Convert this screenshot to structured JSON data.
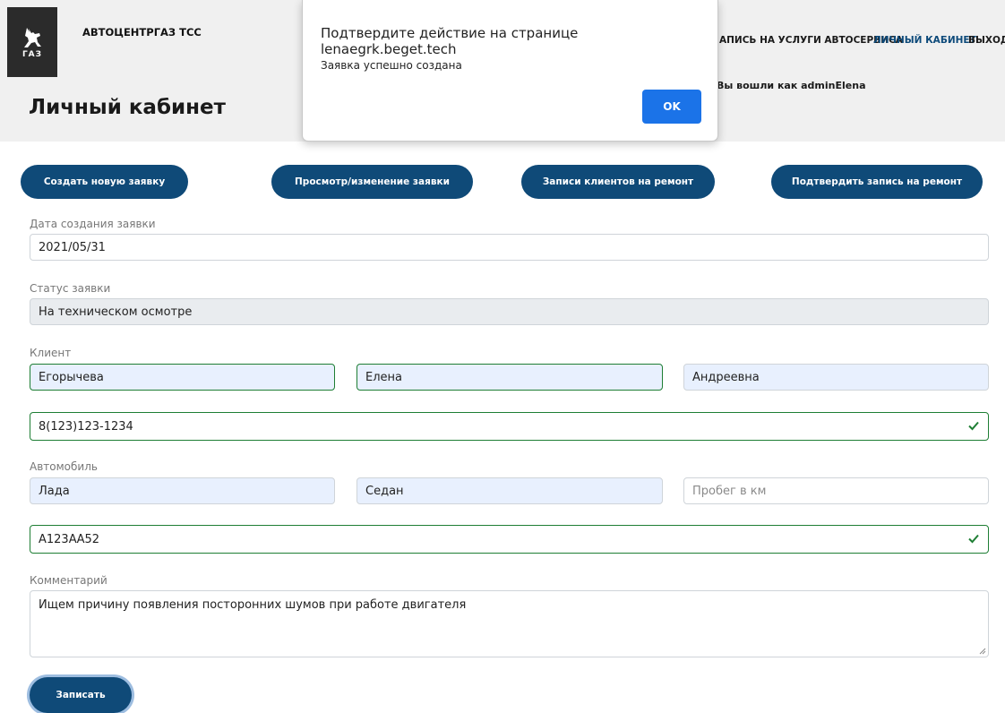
{
  "header": {
    "logo_text": "ГАЗ",
    "brand": "АВТОЦЕНТРГАЗ ТСС",
    "page_title": "Личный кабинет",
    "nav": [
      {
        "label": "АПИСЬ НА УСЛУГИ АВТОСЕРВИСА"
      },
      {
        "label": "ЛИЧНЫЙ КАБИНЕТ"
      },
      {
        "label": "ВЫХОД"
      }
    ],
    "logged_in": "Вы вошли как adminElena"
  },
  "dialog": {
    "title": "Подтвердите действие на странице lenaegrk.beget.tech",
    "message": "Заявка успешно создана",
    "ok_label": "OK"
  },
  "actions": [
    {
      "label": "Создать новую заявку"
    },
    {
      "label": "Просмотр/изменение заявки"
    },
    {
      "label": "Записи клиентов на ремонт"
    },
    {
      "label": "Подтвердить запись на ремонт"
    }
  ],
  "form": {
    "date_label": "Дата создания заявки",
    "date_value": "2021/05/31",
    "status_label": "Статус заявки",
    "status_value": "На техническом осмотре",
    "client_label": "Клиент",
    "last_name": "Егорычева",
    "first_name": "Елена",
    "patronymic": "Андреевна",
    "phone": "8(123)123-1234",
    "car_label": "Автомобиль",
    "car_brand": "Лада",
    "car_body": "Седан",
    "mileage_placeholder": "Пробег в км",
    "plate": "А123АА52",
    "comment_label": "Комментарий",
    "comment": "Ищем причину появления посторонних шумов при работе двигателя",
    "submit_label": "Записать"
  },
  "colors": {
    "primary": "#0f4a78",
    "dialog_button": "#1b73e8",
    "valid": "#1e7e34",
    "autofill": "#e8f0fe"
  }
}
